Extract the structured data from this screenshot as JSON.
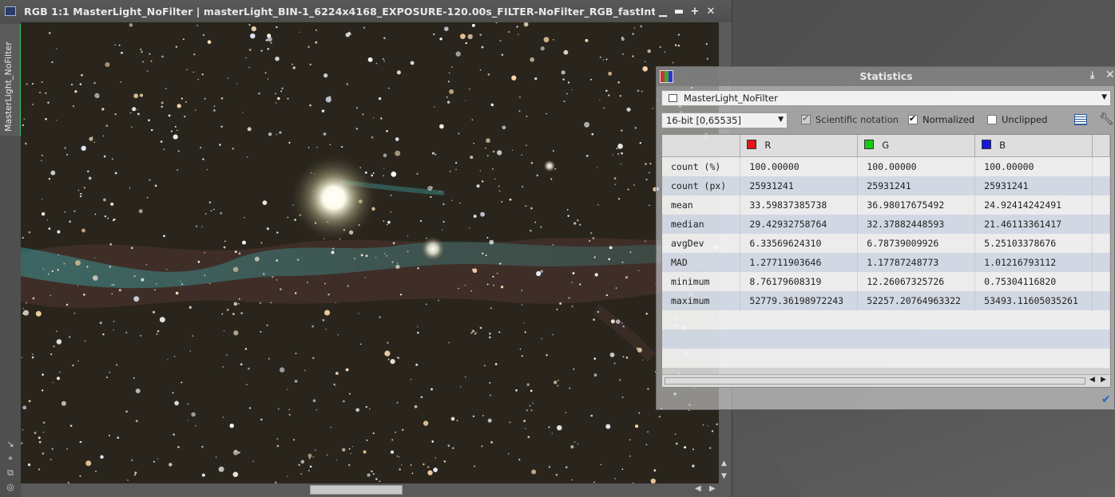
{
  "image_window": {
    "title": "RGB 1:1 MasterLight_NoFilter | masterLight_BIN-1_6224x4168_EXPOSURE-120.00s_FILTER-NoFilter_RGB_fastIntegr...",
    "controls": {
      "minimize": "–",
      "shade": "–",
      "maximize": "+",
      "close": "✕"
    },
    "side_tab_label": "MasterLight_NoFilter"
  },
  "statistics": {
    "title": "Statistics",
    "view": "MasterLight_NoFilter",
    "range": "16-bit [0,65535]",
    "options": [
      {
        "label": "Scientific notation",
        "checked": true,
        "enabled": false
      },
      {
        "label": "Normalized",
        "checked": true,
        "enabled": true
      },
      {
        "label": "Unclipped",
        "checked": false,
        "enabled": true
      }
    ],
    "columns": [
      {
        "label": "R",
        "color": "#e01818"
      },
      {
        "label": "G",
        "color": "#18c818"
      },
      {
        "label": "B",
        "color": "#1818d8"
      }
    ],
    "rows": [
      {
        "label": "count (%)",
        "values": [
          "100.00000",
          "100.00000",
          "100.00000"
        ]
      },
      {
        "label": "count (px)",
        "values": [
          "25931241",
          "25931241",
          "25931241"
        ]
      },
      {
        "label": "mean",
        "values": [
          "33.59837385738",
          "36.98017675492",
          "24.92414242491"
        ]
      },
      {
        "label": "median",
        "values": [
          "29.42932758764",
          "32.37882448593",
          "21.46113361417"
        ]
      },
      {
        "label": "avgDev",
        "values": [
          "6.33569624310",
          "6.78739009926",
          "5.25103378676"
        ]
      },
      {
        "label": "MAD",
        "values": [
          "1.27711903646",
          "1.17787248773",
          "1.01216793112"
        ]
      },
      {
        "label": "minimum",
        "values": [
          "8.76179608319",
          "12.26067325726",
          "0.75304116820"
        ]
      },
      {
        "label": "maximum",
        "values": [
          "52779.36198972243",
          "52257.20764963322",
          "53493.11605035261"
        ]
      }
    ]
  },
  "icons": {
    "app": "pixinsight-window-icon",
    "statistics": "statistics-icon",
    "report": "report-icon",
    "settings": "wrench-icon",
    "ok": "checkmark-icon"
  }
}
